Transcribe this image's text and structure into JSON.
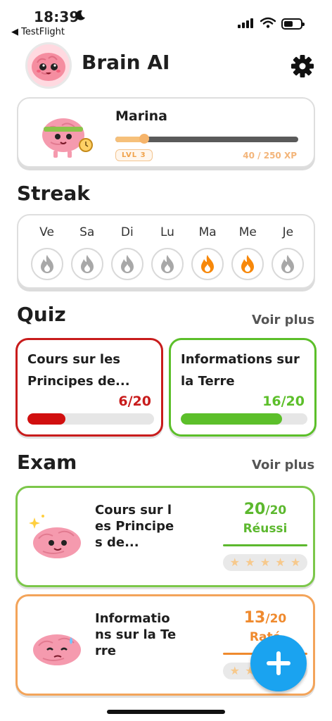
{
  "status_bar": {
    "time": "18:39",
    "back_app": "◀ TestFlight"
  },
  "header": {
    "app_title": "Brain AI",
    "settings_icon": "gear-icon"
  },
  "profile": {
    "name": "Marina",
    "level": "LVL 3",
    "xp_text": "40 / 250 XP",
    "xp_progress": 0.16,
    "colors": {
      "xp_fill": "#f6c07a",
      "track": "#5a5a5a"
    }
  },
  "streak": {
    "title": "Streak",
    "days": [
      {
        "label": "Ve",
        "active": false
      },
      {
        "label": "Sa",
        "active": false
      },
      {
        "label": "Di",
        "active": false
      },
      {
        "label": "Lu",
        "active": false
      },
      {
        "label": "Ma",
        "active": true
      },
      {
        "label": "Me",
        "active": true
      },
      {
        "label": "Je",
        "active": false
      }
    ],
    "colors": {
      "active": "#f7880a",
      "inactive": "#a8a8a8"
    }
  },
  "quiz": {
    "title": "Quiz",
    "see_more": "Voir plus",
    "cards": [
      {
        "title": "Cours sur les Principes de...",
        "score": "6/20",
        "progress": 0.3,
        "color": "#c81c1c"
      },
      {
        "title": "Informations sur la Terre",
        "score": "16/20",
        "progress": 0.8,
        "color": "#5cbf2a"
      }
    ]
  },
  "exam": {
    "title": "Exam",
    "see_more": "Voir plus",
    "cards": [
      {
        "title": "Cours sur les Principes de...",
        "score": "20",
        "total": "/20",
        "status": "Réussi",
        "stars": 5,
        "color": "#5cb82e"
      },
      {
        "title": "Informations sur la Terre",
        "score": "13",
        "total": "/20",
        "status": "Raté",
        "stars": 5,
        "color": "#ef8a2e"
      }
    ]
  },
  "fab": {
    "icon": "plus-icon"
  }
}
